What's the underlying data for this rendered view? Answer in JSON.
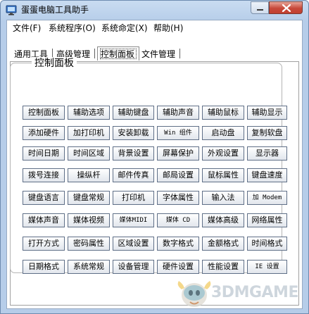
{
  "window": {
    "title": "蛋蛋电脑工具助手"
  },
  "menubar": {
    "items": [
      {
        "label": "文件(F)"
      },
      {
        "label": "系统程序(O)"
      },
      {
        "label": "系统命定(X)"
      },
      {
        "label": "帮助(H)"
      }
    ]
  },
  "tabs": {
    "items": [
      {
        "label": "通用工具"
      },
      {
        "label": "高级管理"
      },
      {
        "label": "控制面板"
      },
      {
        "label": "文件管理"
      }
    ],
    "active": "控制面板"
  },
  "panel": {
    "group_title": "控制面板",
    "buttons": [
      [
        "控制面板",
        "辅助选项",
        "辅助键盘",
        "辅助声音",
        "辅助鼠标",
        "辅助显示"
      ],
      [
        "添加硬件",
        "加打印机",
        "安装卸载",
        "Win 组件",
        "启动盘",
        "复制软盘"
      ],
      [
        "时间日期",
        "时间区域",
        "背景设置",
        "屏幕保护",
        "外观设置",
        "显示器"
      ],
      [
        "拨号连接",
        "操纵杆",
        "邮件传真",
        "邮局设置",
        "鼠标属性",
        "键盘速度"
      ],
      [
        "键盘语言",
        "键盘常规",
        "打印机",
        "字体属性",
        "输入法",
        "加 Modem"
      ],
      [
        "媒体声音",
        "媒体视频",
        "媒体MIDI",
        "媒体 CD",
        "媒体高级",
        "网络属性"
      ],
      [
        "打开方式",
        "密码属性",
        "区域设置",
        "数字格式",
        "金额格式",
        "时间格式"
      ],
      [
        "日期格式",
        "系统常规",
        "设备管理",
        "硬件设置",
        "性能设置",
        "IE 设置"
      ]
    ]
  },
  "watermark": {
    "text": "3DMGAME"
  },
  "colors": {
    "frame": "#b6cde9",
    "close_button": "#c7493a",
    "button_border": "#5f6f87"
  },
  "icons": {
    "app": "app-icon",
    "close": "close-icon",
    "minimize": "minimize-icon"
  }
}
